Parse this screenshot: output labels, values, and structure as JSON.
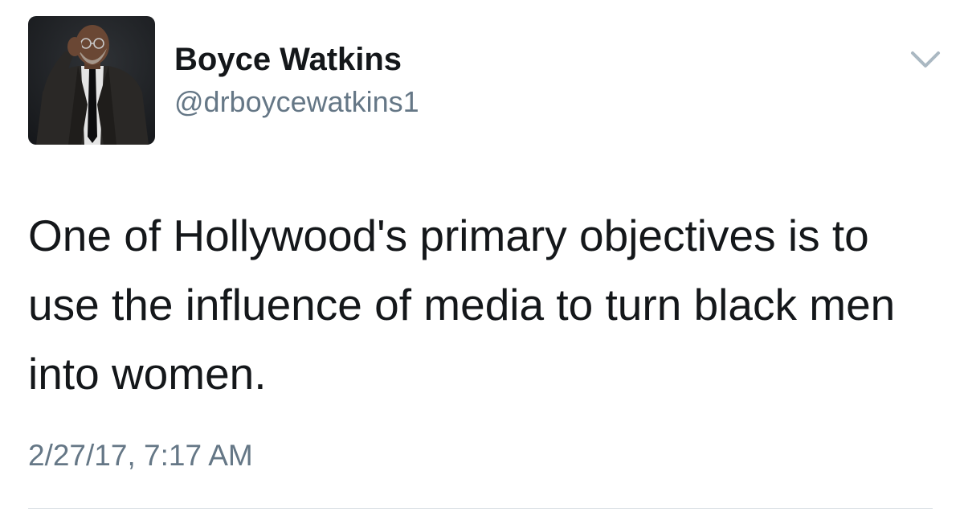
{
  "tweet": {
    "author": {
      "display_name": "Boyce Watkins",
      "handle": "@drboycewatkins1",
      "avatar_icon": "profile-photo"
    },
    "menu_icon": "chevron-down-icon",
    "text": "One of Hollywood's primary objectives is to use the influence of media to turn black men into women.",
    "timestamp": "2/27/17, 7:17 AM"
  },
  "colors": {
    "text_primary": "#14171a",
    "text_secondary": "#657786",
    "chevron": "#aab8c2",
    "divider": "#d7dde3",
    "background": "#ffffff"
  }
}
